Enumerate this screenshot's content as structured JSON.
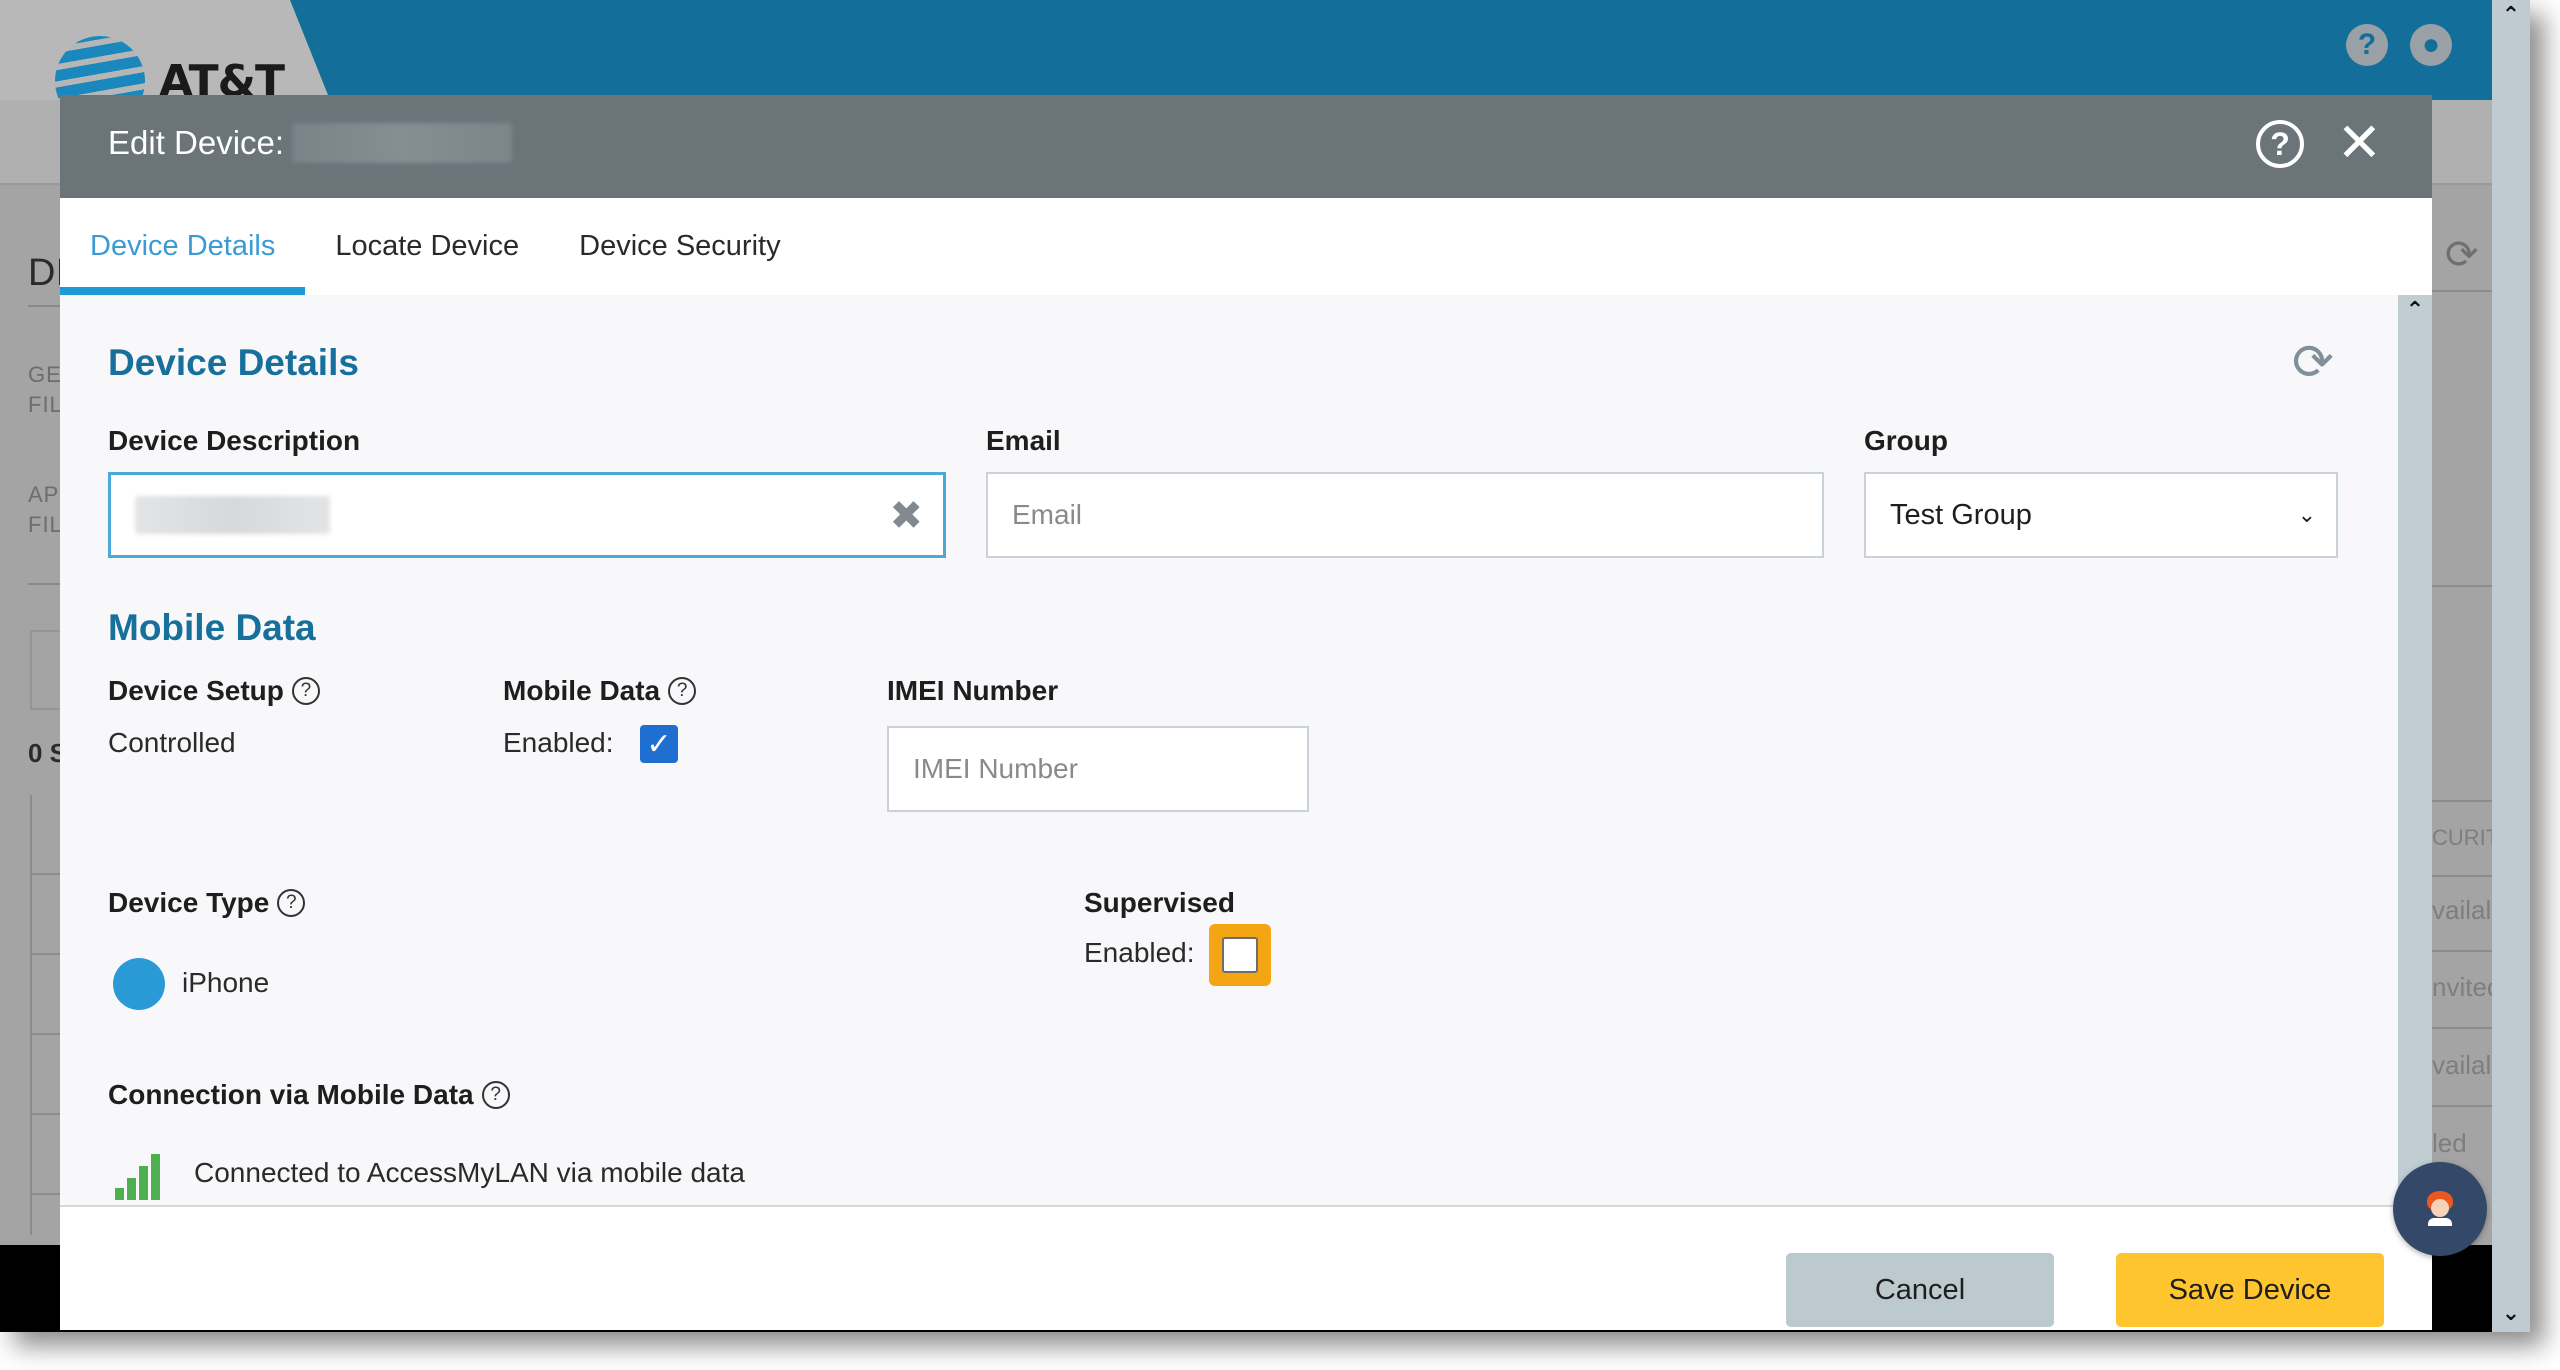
{
  "background": {
    "brand": "AT&T",
    "header_icons": [
      "help-icon",
      "account-icon"
    ],
    "page_title_fragment": "DI",
    "filter_labels": [
      "GE",
      "FIL",
      "AP",
      "FIL"
    ],
    "count_fragment": "0 S",
    "right_column_fragments": [
      "CURIT",
      "vailal",
      "nvitec",
      "vailal",
      "led"
    ],
    "colors": {
      "header_blue": "#136f99"
    }
  },
  "modal": {
    "title": "Edit Device:",
    "title_value_redacted": true,
    "help_icon": "help-circle-icon",
    "close_icon": "close-icon",
    "tabs": [
      {
        "label": "Device Details",
        "active": true
      },
      {
        "label": "Locate Device",
        "active": false
      },
      {
        "label": "Device Security",
        "active": false
      }
    ],
    "device_details": {
      "section_title": "Device Details",
      "refresh_icon": "refresh-icon",
      "description": {
        "label": "Device Description",
        "value_redacted": true,
        "clear_icon": "clear-icon"
      },
      "email": {
        "label": "Email",
        "value": "",
        "placeholder": "Email"
      },
      "group": {
        "label": "Group",
        "selected": "Test Group"
      }
    },
    "mobile_data": {
      "section_title": "Mobile Data",
      "device_setup": {
        "label": "Device Setup",
        "value": "Controlled"
      },
      "mobile_data_toggle": {
        "label": "Mobile Data",
        "enabled_label": "Enabled:",
        "checked": true
      },
      "imei": {
        "label": "IMEI Number",
        "value": "",
        "placeholder": "IMEI Number"
      },
      "device_type": {
        "label": "Device Type",
        "value": "iPhone"
      },
      "supervised": {
        "label": "Supervised",
        "enabled_label": "Enabled:",
        "checked": false
      },
      "connection": {
        "label": "Connection via Mobile Data",
        "status": "Connected to AccessMyLAN via mobile data"
      }
    },
    "footer": {
      "cancel_label": "Cancel",
      "save_label": "Save Device"
    },
    "colors": {
      "accent": "#1d9ad6",
      "section_title": "#17709c",
      "save_button": "#ffc52e",
      "cancel_button": "#bcc9ce",
      "checkbox": "#1f6fd1",
      "highlight": "#f4a513",
      "signal": "#4caf50"
    }
  }
}
